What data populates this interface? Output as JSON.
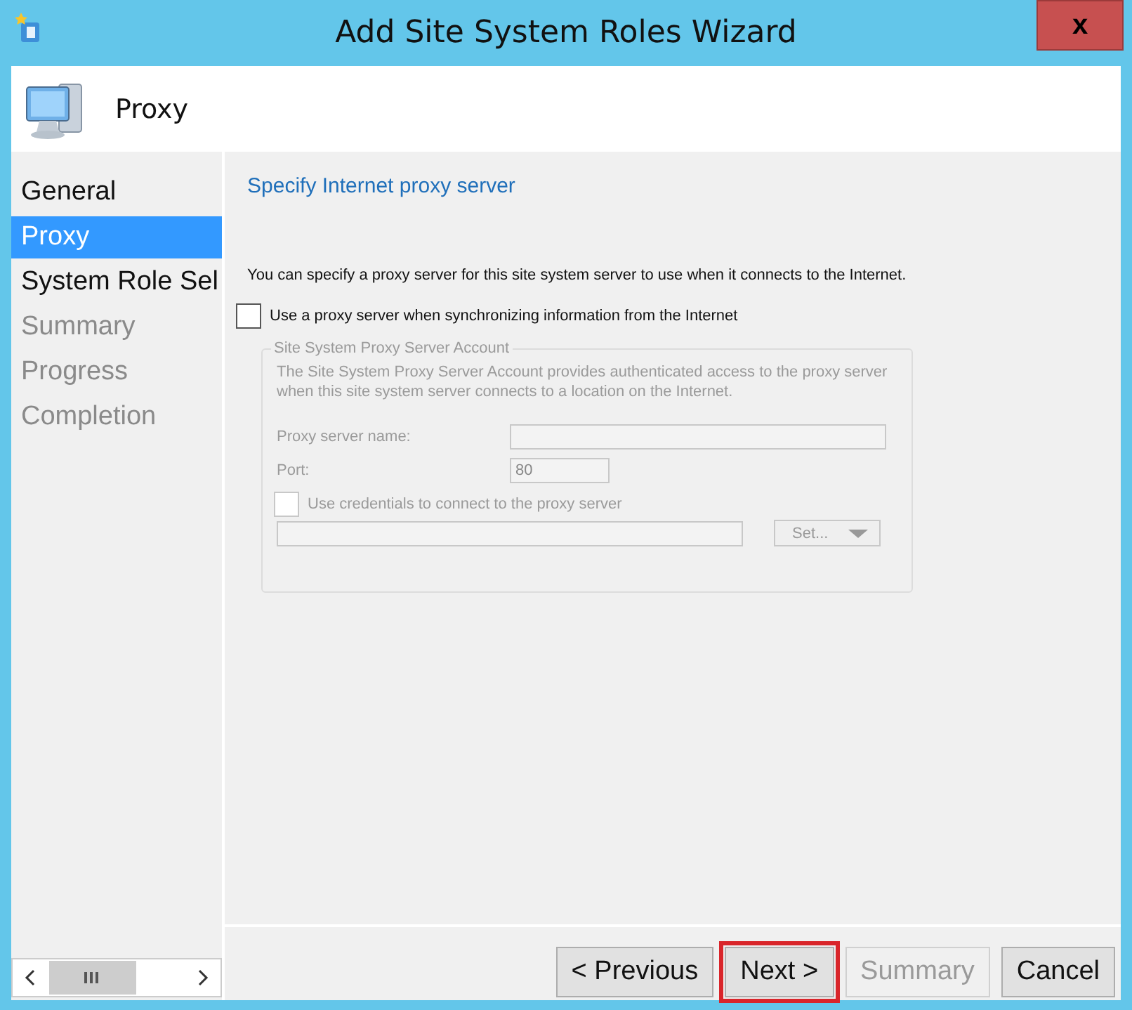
{
  "window": {
    "title": "Add Site System Roles Wizard",
    "close_label": "x"
  },
  "header": {
    "title": "Proxy"
  },
  "sidebar": {
    "items": [
      {
        "label": "General",
        "selected": false,
        "disabled": false
      },
      {
        "label": "Proxy",
        "selected": true,
        "disabled": false
      },
      {
        "label": "System Role Sel",
        "selected": false,
        "disabled": false
      },
      {
        "label": "Summary",
        "selected": false,
        "disabled": true
      },
      {
        "label": "Progress",
        "selected": false,
        "disabled": true
      },
      {
        "label": "Completion",
        "selected": false,
        "disabled": true
      }
    ]
  },
  "content": {
    "heading": "Specify Internet proxy server",
    "description": "You can specify a proxy server for this site system server to use when it connects to the Internet.",
    "use_proxy": {
      "label": "Use a proxy server when synchronizing information from the Internet",
      "checked": false
    },
    "account_group": {
      "title": "Site System Proxy Server Account",
      "disabled": true,
      "description": "The Site System Proxy Server Account provides authenticated access to the proxy server when this site system server connects to a location on the Internet.",
      "server_name": {
        "label": "Proxy server name:"
      },
      "port": {
        "label": "Port:",
        "value": "80"
      },
      "use_credentials": {
        "label": "Use credentials to connect to the proxy server",
        "checked": false
      },
      "set_button": "Set..."
    }
  },
  "buttons": [
    {
      "label": "< Previous",
      "disabled": false,
      "highlighted": false
    },
    {
      "label": "Next >",
      "disabled": false,
      "highlighted": true
    },
    {
      "label": "Summary",
      "disabled": true,
      "highlighted": false
    },
    {
      "label": "Cancel",
      "disabled": false,
      "highlighted": false
    }
  ]
}
